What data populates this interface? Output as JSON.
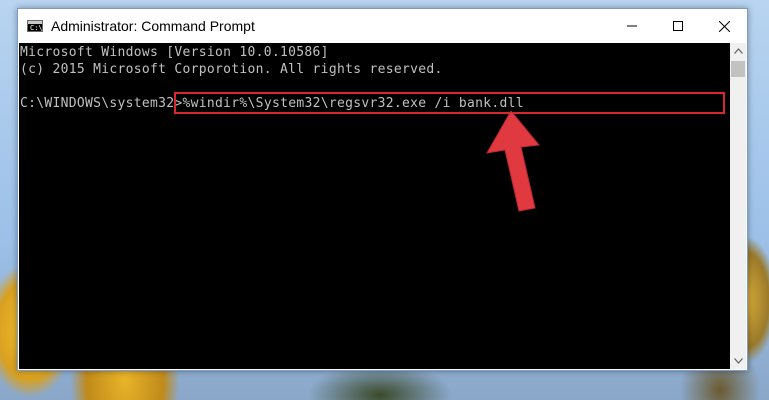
{
  "window": {
    "title": "Administrator: Command Prompt",
    "icon": "cmd-app-icon",
    "controls": [
      "minimize-icon",
      "maximize-icon",
      "close-icon"
    ]
  },
  "console": {
    "lines": [
      "Microsoft Windows [Version 10.0.10586]",
      "(c) 2015 Microsoft Corporotion. All rights reserved.",
      ""
    ],
    "prompt": "C:\\WINDOWS\\system32>",
    "command": "%windir%\\System32\\regsvr32.exe /i bank.dll"
  },
  "annotation": {
    "highlight_color": "#d9272e",
    "arrow_color": "#e0393f"
  }
}
